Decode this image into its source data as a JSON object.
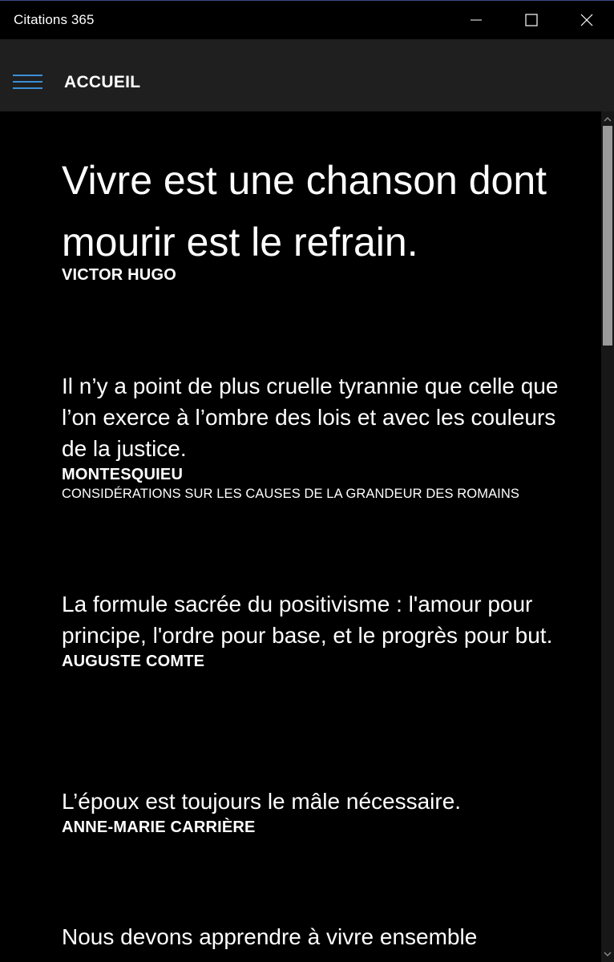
{
  "window": {
    "title": "Citations 365",
    "minimize_icon": "minimize-icon",
    "maximize_icon": "maximize-icon",
    "close_icon": "close-icon"
  },
  "header": {
    "menu_icon": "hamburger-menu-icon",
    "title": "ACCUEIL",
    "accent_color": "#3b8fd6"
  },
  "quotes": [
    {
      "text": "Vivre est une chanson dont mourir est le refrain.",
      "author": "VICTOR HUGO",
      "source": ""
    },
    {
      "text": "Il n’y a point de plus cruelle tyrannie que celle que l’on exerce à l’ombre des lois et avec les couleurs de la justice.",
      "author": "MONTESQUIEU",
      "source": "CONSIDÉRATIONS SUR LES CAUSES DE LA GRANDEUR DES ROMAINS"
    },
    {
      "text": "La formule sacrée du positivisme : l'amour pour principe, l'ordre pour base, et le progrès pour but.",
      "author": "AUGUSTE COMTE",
      "source": ""
    },
    {
      "text": "L’époux est toujours le mâle nécessaire.",
      "author": "ANNE-MARIE CARRIÈRE",
      "source": ""
    },
    {
      "text": "Nous devons apprendre à vivre ensemble",
      "author": "",
      "source": ""
    }
  ],
  "scrollbar": {
    "up_icon": "scroll-up-arrow-icon",
    "down_icon": "scroll-down-arrow-icon",
    "position_fraction": 0.0
  }
}
